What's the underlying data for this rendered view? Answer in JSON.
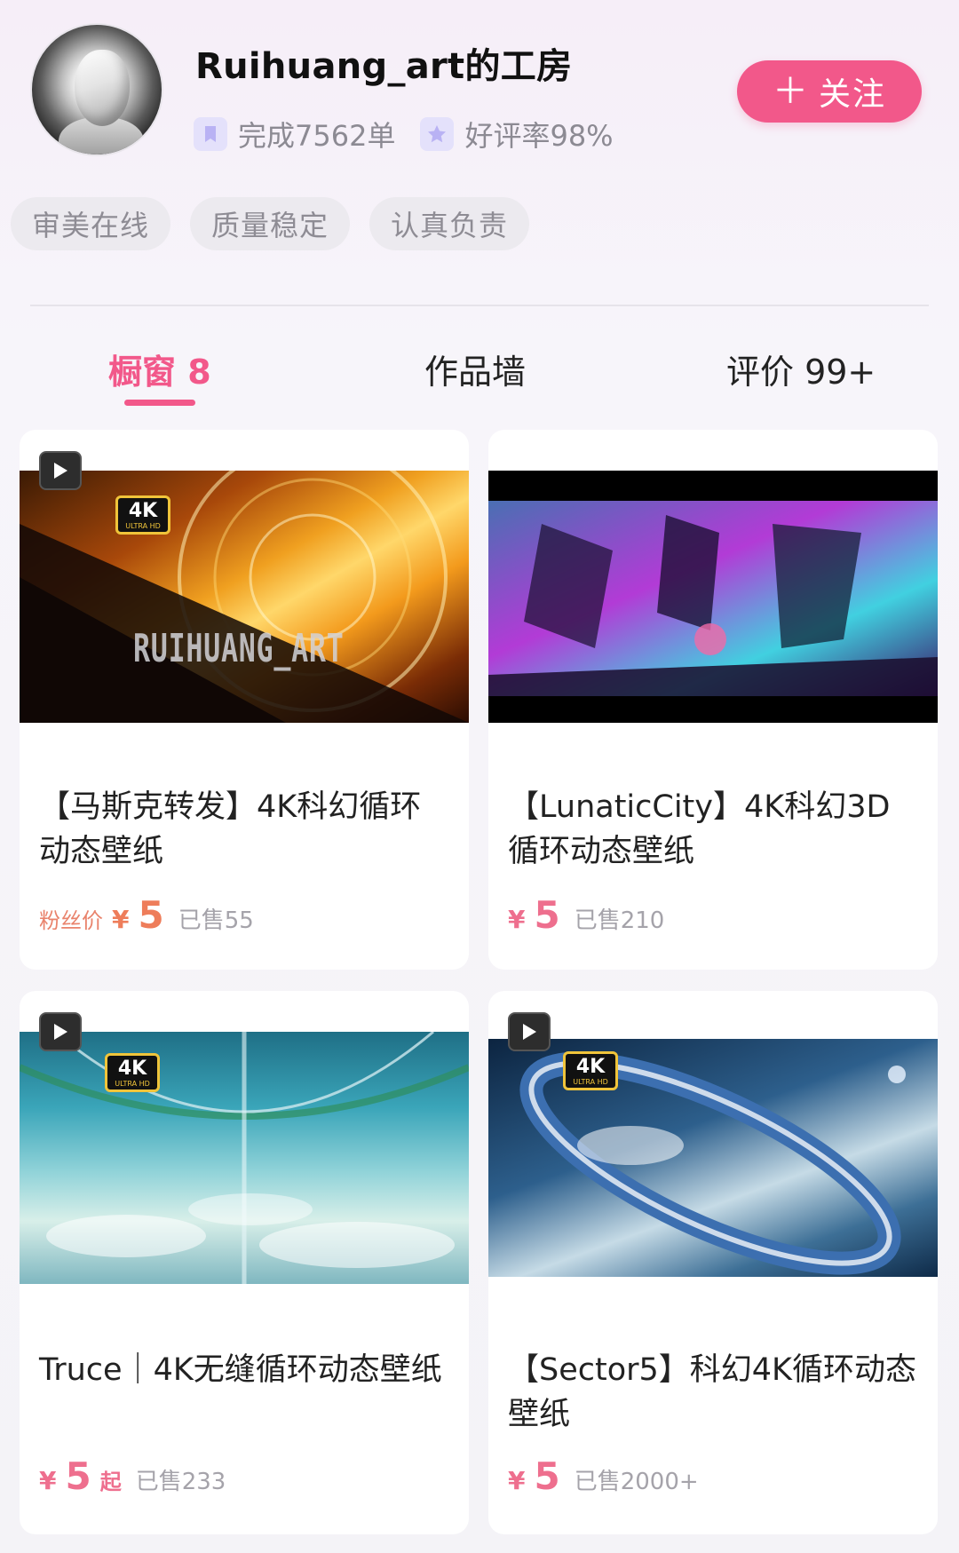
{
  "header": {
    "shop_name": "Ruihuang_art的工房",
    "completed": "完成7562单",
    "rating": "好评率98%",
    "follow_label": "关注",
    "follow_icon": "plus-icon"
  },
  "tags": [
    "审美在线",
    "质量稳定",
    "认真负责"
  ],
  "tabs": [
    {
      "label": "橱窗 8",
      "active": true
    },
    {
      "label": "作品墙",
      "active": false
    },
    {
      "label": "评价 99+",
      "active": false
    }
  ],
  "products": [
    {
      "title": "【马斯克转发】4K科幻循环动态壁纸",
      "fan_label": "粉丝价",
      "currency": "¥",
      "price": "5",
      "price_suffix": "",
      "sold": "已售55",
      "watermark": "RUIHUANG_ART",
      "has_video": true,
      "has_4k_badge": true
    },
    {
      "title": "【LunaticCity】4K科幻3D循环动态壁纸",
      "fan_label": "",
      "currency": "¥",
      "price": "5",
      "price_suffix": "",
      "sold": "已售210",
      "has_video": false,
      "has_4k_badge": false
    },
    {
      "title": "Truce｜4K无缝循环动态壁纸",
      "fan_label": "",
      "currency": "¥",
      "price": "5",
      "price_suffix": "起",
      "sold": "已售233",
      "has_video": true,
      "has_4k_badge": true
    },
    {
      "title": "【Sector5】科幻4K循环动态壁纸",
      "fan_label": "",
      "currency": "¥",
      "price": "5",
      "price_suffix": "",
      "sold": "已售2000+",
      "has_video": true,
      "has_4k_badge": true
    }
  ],
  "badge_4k": {
    "main": "4K",
    "sub": "ULTRA HD"
  },
  "colors": {
    "accent": "#f2588a",
    "price": "#ee6f8e",
    "fan_label": "#e9836c",
    "muted": "#a5a3aa"
  }
}
